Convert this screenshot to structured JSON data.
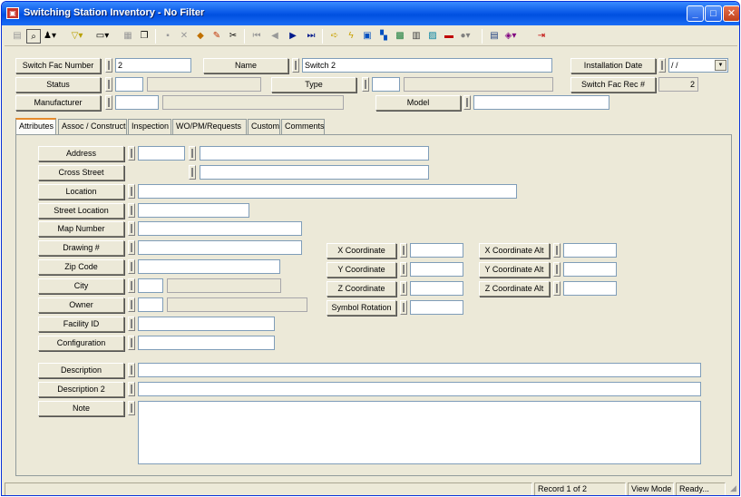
{
  "window": {
    "title": "Switching Station Inventory - No Filter",
    "minimize": "_",
    "maximize": "□",
    "close": "✕"
  },
  "toolbar": {
    "icons": [
      "new-record-icon",
      "find-icon",
      "query-icon",
      "filter-icon",
      "print-icon",
      "view-icon",
      "copy-icon",
      "save-icon",
      "delete-icon",
      "layers-icon",
      "edit-pencil-icon",
      "cut-icon",
      "first-record-icon",
      "prev-record-icon",
      "next-record-icon",
      "last-record-icon",
      "jump-icon",
      "flash-icon",
      "report-icon",
      "tree-icon",
      "image-icon",
      "calendar-icon",
      "map-icon",
      "toolbox-icon",
      "gis-icon",
      "window-icon",
      "books-icon",
      "exit-icon"
    ]
  },
  "header": {
    "switch_fac_number": {
      "label": "Switch Fac Number",
      "value": "2"
    },
    "name": {
      "label": "Name",
      "value": "Switch 2"
    },
    "installation_date": {
      "label": "Installation Date",
      "value": " / /"
    },
    "status": {
      "label": "Status",
      "value": ""
    },
    "type": {
      "label": "Type",
      "value": ""
    },
    "switch_fac_rec": {
      "label": "Switch Fac Rec #",
      "value": "2"
    },
    "manufacturer": {
      "label": "Manufacturer",
      "value": ""
    },
    "model": {
      "label": "Model",
      "value": ""
    }
  },
  "tabs": [
    "Attributes",
    "Assoc / Construct",
    "Inspection",
    "WO/PM/Requests",
    "Custom",
    "Comments"
  ],
  "attributes": {
    "address": "Address",
    "cross_street": "Cross Street",
    "location": "Location",
    "street_location": "Street Location",
    "map_number": "Map Number",
    "drawing": "Drawing #",
    "zip_code": "Zip Code",
    "city": "City",
    "owner": "Owner",
    "facility_id": "Facility ID",
    "configuration": "Configuration",
    "description": "Description",
    "description2": "Description 2",
    "note": "Note",
    "x_coord": "X Coordinate",
    "y_coord": "Y Coordinate",
    "z_coord": "Z Coordinate",
    "symbol_rotation": "Symbol Rotation",
    "x_coord_alt": "X Coordinate Alt",
    "y_coord_alt": "Y Coordinate Alt",
    "z_coord_alt": "Z Coordinate Alt"
  },
  "statusbar": {
    "record": "Record 1 of 2",
    "mode": "View Mode",
    "state": "Ready..."
  }
}
